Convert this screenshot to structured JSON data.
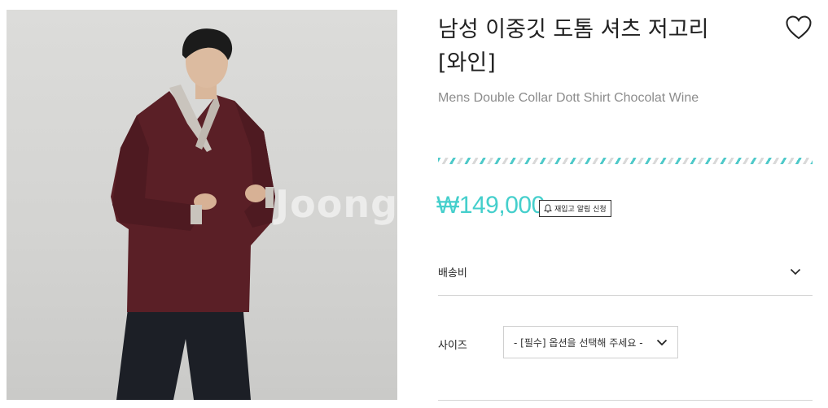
{
  "product": {
    "title_line1": "남성 이중깃 도톰 셔츠 저고리",
    "title_line2": "[와인]",
    "subtitle": "Mens Double Collar Dott Shirt Chocolat Wine",
    "price": "₩149,000",
    "image_watermark": "Joong"
  },
  "actions": {
    "wishlist_icon": "heart-outline-icon",
    "restock_label": "재입고 알림 신청",
    "restock_icon": "bell-icon"
  },
  "shipping": {
    "label": "배송비",
    "icon": "chevron-down-icon"
  },
  "options": {
    "size_label": "사이즈",
    "size_selected": "- [필수] 옵션을 선택해 주세요 -",
    "size_icon": "chevron-down-icon"
  },
  "colors": {
    "accent": "#45cfcc",
    "garment": "#5a1f26",
    "text": "#222222",
    "muted": "#8c8c8c"
  }
}
